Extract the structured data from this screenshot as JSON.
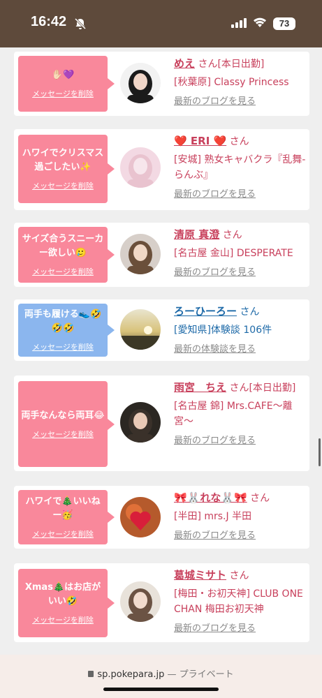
{
  "status_bar": {
    "time": "16:42",
    "battery": "73"
  },
  "browser": {
    "url": "sp.pokepara.jp",
    "separator": " — ",
    "mode": "プライベート"
  },
  "messages": [
    {
      "message": "✋🏻💜",
      "delete_label": "メッセージを削除",
      "name": "めえ",
      "san": "さん",
      "after_san": "[本日出勤]",
      "shop": "[秋葉原] Classy Princess",
      "blog": "最新のブログを見る",
      "bubble_color": "#f9889b"
    },
    {
      "message": "ハワイでクリスマス過ごしたい✨",
      "delete_label": "メッセージを削除",
      "name": "❤️ ERI ❤️",
      "san": "さん",
      "after_san": "",
      "shop": "[安城] 熟女キャバクラ『乱舞-らんぶ』",
      "blog": "最新のブログを見る",
      "bubble_color": "#f9889b"
    },
    {
      "message": "サイズ合うスニーカー欲しい🥲",
      "delete_label": "メッセージを削除",
      "name": "清原 真澄",
      "san": "さん",
      "after_san": "",
      "shop": "[名古屋 金山] DESPERATE",
      "blog": "最新のブログを見る",
      "bubble_color": "#f9889b"
    },
    {
      "message": "両手も履ける👟🤣🤣🤣",
      "delete_label": "メッセージを削除",
      "name": "ろーひーろー",
      "san": "さん",
      "after_san": "",
      "shop": "[愛知県]体験談 106件",
      "blog": "最新の体験談を見る",
      "bubble_color": "#8bb6ee"
    },
    {
      "message": "両手なんなら両耳😂",
      "delete_label": "メッセージを削除",
      "name": "雨宮　ちえ",
      "san": "さん",
      "after_san": "[本日出勤]",
      "shop": "[名古屋 錦] Mrs.CAFE〜離宮〜",
      "blog": "最新のブログを見る",
      "bubble_color": "#f9889b"
    },
    {
      "message": "ハワイで🎄いいねー🥳",
      "delete_label": "メッセージを削除",
      "name": "🎀🐰れな🐰🎀",
      "san": "さん",
      "after_san": "",
      "shop": "[半田] mrs.J 半田",
      "blog": "最新のブログを見る",
      "bubble_color": "#f9889b"
    },
    {
      "message": "Xmas🎄はお店がいい🤣",
      "delete_label": "メッセージを削除",
      "name": "葛城ミサト",
      "san": "さん",
      "after_san": "",
      "shop": "[梅田・お初天神] CLUB ONE CHAN 梅田お初天神",
      "blog": "最新のブログを見る",
      "bubble_color": "#f9889b"
    }
  ]
}
